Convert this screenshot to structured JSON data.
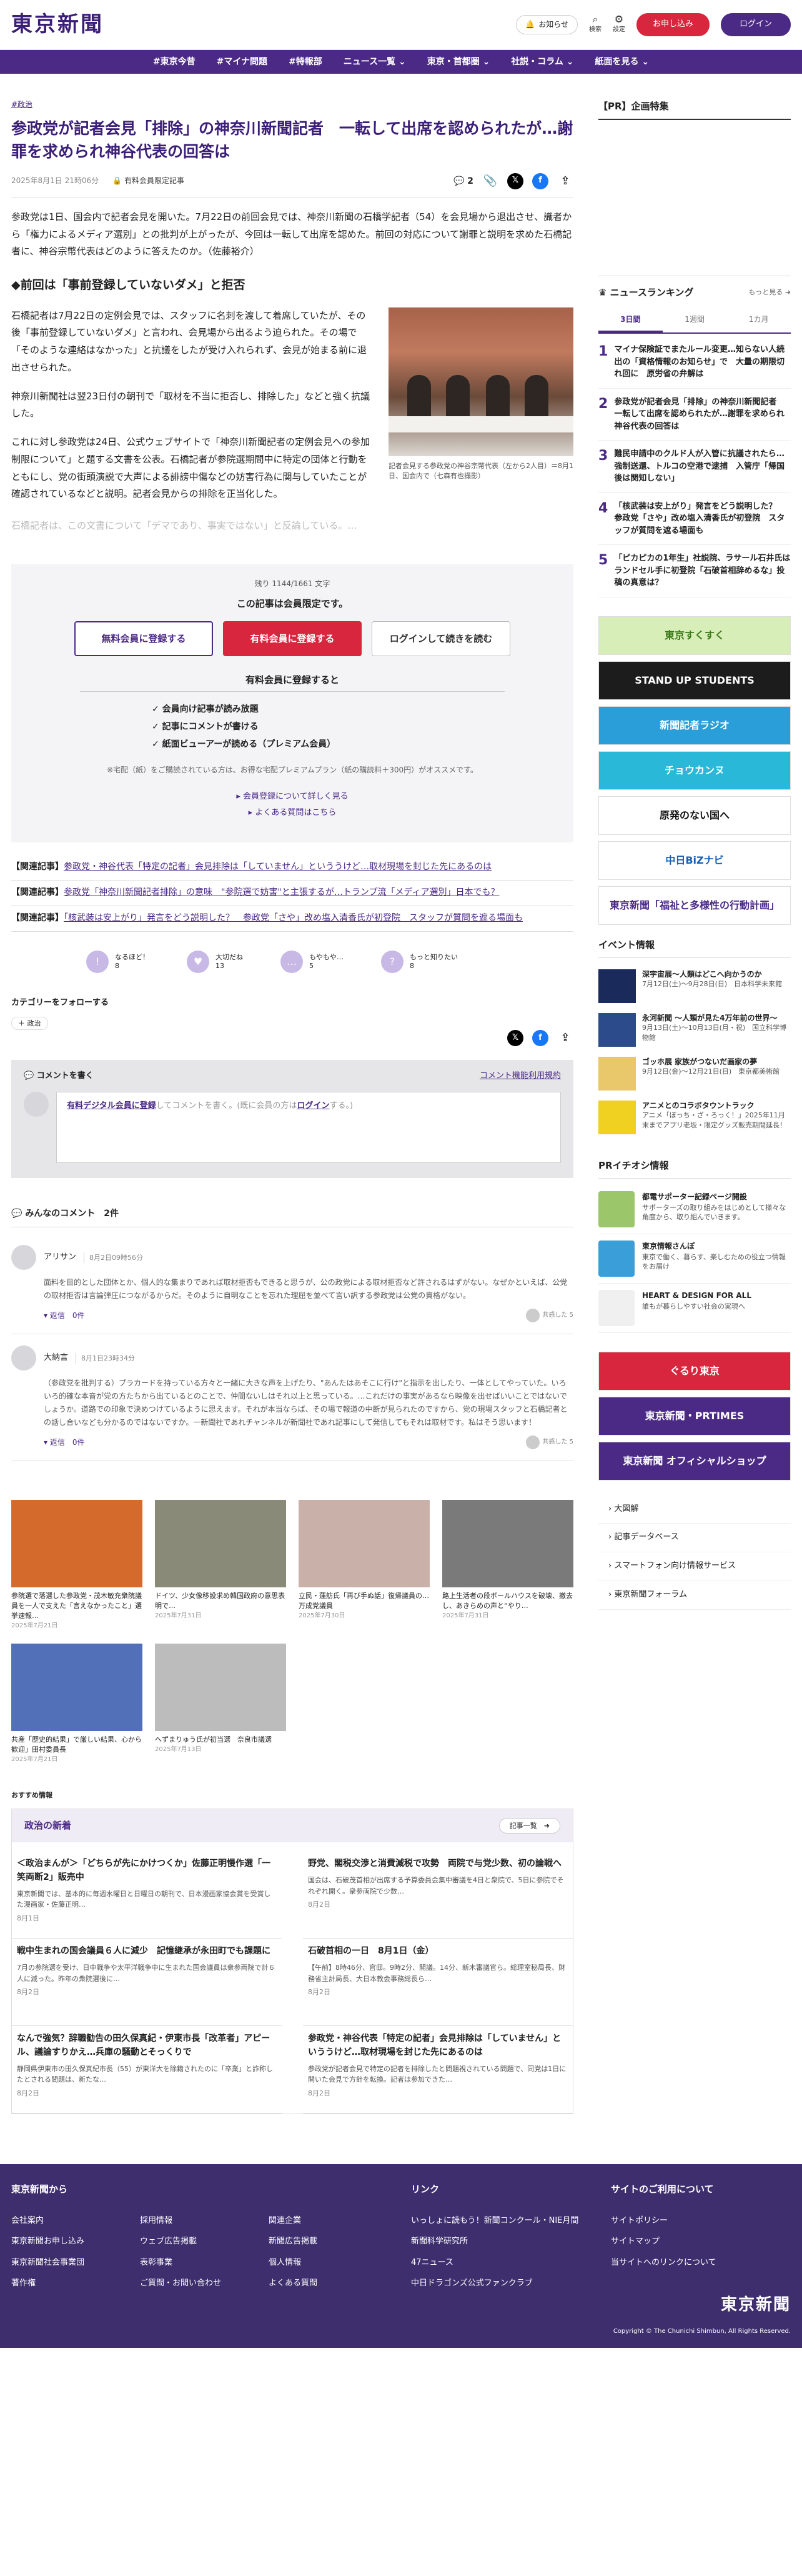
{
  "header": {
    "logo": "東京新聞",
    "notice": "お知らせ",
    "search": "検索",
    "settings": "設定",
    "apply": "お申し込み",
    "login": "ログイン"
  },
  "nav": [
    "#東京今昔",
    "#マイナ問題",
    "#特報部",
    "ニュース一覧 ⌄",
    "東京・首都圏 ⌄",
    "社説・コラム ⌄",
    "紙面を見る ⌄"
  ],
  "article": {
    "breadcrumb": "#政治",
    "title": "参政党が記者会見「排除」の神奈川新聞記者　一転して出席を認められたが…謝罪を求められ神谷代表の回答は",
    "date": "2025年8月1日 21時06分",
    "paid": "有料会員限定記事",
    "comment_count": "2",
    "lede": "参政党は1日、国会内で記者会見を開いた。7月22日の前回会見では、神奈川新聞の石橋学記者（54）を会見場から退出させ、識者から「権力によるメディア選別」との批判が上がったが、今回は一転して出席を認めた。前回の対応について謝罪と説明を求めた石橋記者に、神谷宗幣代表はどのように答えたのか。（佐藤裕介）",
    "heading": "◆前回は「事前登録していないダメ」と拒否",
    "paragraphs": [
      "石橋記者は7月22日の定例会見では、スタッフに名刺を渡して着席していたが、その後「事前登録していないダメ」と言われ、会見場から出るよう迫られた。その場で「そのような連絡はなかった」と抗議をしたが受け入れられず、会見が始まる前に退出させられた。",
      "神奈川新聞社は翌23日付の朝刊で「取材を不当に拒否し、排除した」などと強く抗議した。",
      "これに対し参政党は24日、公式ウェブサイトで「神奈川新聞記者の定例会見への参加制限について」と題する文書を公表。石橋記者が参院選期間中に特定の団体と行動をともにし、党の街頭演説で大声による誹謗中傷などの妨害行為に関与していたことが確認されているなどと説明。記者会見からの排除を正当化した。"
    ],
    "fade": "石橋記者は、この文書について「デマであり、事実ではない」と反論している。…",
    "caption": "記者会見する参政党の神谷宗幣代表（左から2人目）＝8月1日、国会内で（七森有也撮影）"
  },
  "paywall": {
    "remaining": "残り 1144/1661 文字",
    "limited": "この記事は会員限定です。",
    "free_btn": "無料会員に登録する",
    "paid_btn": "有料会員に登録する",
    "login_btn": "ログインして続きを読む",
    "benefit_title": "有料会員に登録すると",
    "benefits": [
      "✓ 会員向け記事が読み放題",
      "✓ 記事にコメントが書ける",
      "✓ 紙面ビューアーが読める（プレミアム会員）"
    ],
    "note": "※宅配（紙）をご購読されている方は、お得な宅配プレミアムプラン（紙の購読料＋300円）がオススメです。",
    "link1": "▸ 会員登録について詳しく見る",
    "link2": "▸ よくある質問はこちら"
  },
  "related": [
    {
      "tag": "【関連記事】",
      "text": "参政党・神谷代表「特定の記者」会見排除は「していません」といううけど…取材現場を封じた先にあるのは"
    },
    {
      "tag": "【関連記事】",
      "text": "参政党「神奈川新聞記者排除」の意味　\"参院選で妨害\"と主張するが…トランプ流「メディア選別」日本でも？"
    },
    {
      "tag": "【関連記事】",
      "text": "「核武装は安上がり」発言をどう説明した？　参政党「さや」改め塩入清香氏が初登院　スタッフが質問を遮る場面も"
    }
  ],
  "reactions": [
    {
      "label": "なるほど！",
      "count": "8",
      "icon": "!"
    },
    {
      "label": "大切だね",
      "count": "13",
      "icon": "♥"
    },
    {
      "label": "もやもや…",
      "count": "5",
      "icon": "…"
    },
    {
      "label": "もっと知りたい",
      "count": "8",
      "icon": "?"
    }
  ],
  "follow": {
    "title": "カテゴリーをフォローする",
    "tag": "＋ 政治"
  },
  "comment_box": {
    "title": "コメントを書く",
    "rules": "コメント機能利用規約",
    "prompt_pre": "有料デジタル会員に登録",
    "prompt_mid": "してコメントを書く。(既に会員の方は",
    "prompt_login": "ログイン",
    "prompt_end": "する。)"
  },
  "comments": {
    "title": "みんなのコメント　2件",
    "items": [
      {
        "name": "アリサン",
        "date": "8月2日09時56分",
        "text": "面料を目的とした団体とか、個人的な集まりであれば取材拒否もできると思うが、公の政党による取材拒否など許されるはずがない。なぜかといえば、公党の取材拒否は言論弾圧につながるからだ。そのように自明なことを忘れた理屈を並べて言い訳する参政党は公党の資格がない。",
        "reply": "▾ 返信　0件",
        "share": "共感した 5"
      },
      {
        "name": "大納言",
        "date": "8月1日23時34分",
        "text": "（参政党を批判する）プラカードを持っている方々と一緒に大きな声を上げたり、\"あんたはあそこに行け\"と指示を出したり、一体としてやっていた。いろいろ的確な本音が党の方たちから出ているとのことで、仲間ないしはそれ以上と思っている。…これだけの事実があるなら映像を出せばいいことではないでしょうか。道路での印象で決めつけているように思えます。それが本当ならば、その場で報道の中断が見られたのですから、党の現場スタッフと石橋記者との話し合いなども分かるのではないですか。一新聞社であれチャンネルが新聞社であれ記事にして発信してもそれは取材です。私はそう思います！",
        "reply": "▾ 返信　0件",
        "share": "共感した 5"
      }
    ]
  },
  "cards": [
    {
      "title": "参院選で落選した参政党・茂木敏充衆院議員を一人で支えた「言えなかったこと」選挙速報…",
      "date": "2025年7月21日",
      "color": "#d46a2c"
    },
    {
      "title": "ドイツ、少女像移設求め韓国政府の意思表明で…",
      "date": "2025年7月31日",
      "color": "#8a8a78"
    },
    {
      "title": "立民・蓮舫氏「再び手ぬ話」復帰議員の…万成党議員",
      "date": "2025年7月30日",
      "color": "#c9b0a8"
    },
    {
      "title": "路上生活者の段ボールハウスを破壊、撤去し、あきらめの声と“やり…",
      "date": "2025年7月31日",
      "color": "#7a7a7a"
    },
    {
      "title": "共産「歴史的結果」で厳しい結果、心から歓迎」田村委員長",
      "date": "2025年7月21日",
      "color": "#5270b8"
    },
    {
      "title": "へずまりゅう氏が初当選　奈良市議選",
      "date": "2025年7月13日",
      "color": "#bcbcbc"
    }
  ],
  "recommend": {
    "label": "おすすめ情報",
    "box_title": "政治の新着",
    "more": "記事一覧　➜",
    "items": [
      {
        "title": "＜政治まんが＞「どちらが先にかけつくか」佐藤正明慢作選「一笑両断2」販売中",
        "text": "東京新聞では、基本的に毎週水曜日と日曜日の朝刊で、日本漫画家協会賞を受賞した漫画家・佐藤正明…",
        "date": "8月1日"
      },
      {
        "title": "野党、閣税交渉と消費減税で攻勢　両院で与党少数、初の論戦へ",
        "text": "国会は、石破茂首相が出席する予算委員会集中審議を4日と衆院で、5日に参院でそれぞれ開く。衆参両院で少数…",
        "date": "8月2日"
      },
      {
        "title": "戦中生まれの国会議員６人に減少　記憶継承が永田町でも課題に",
        "text": "7月の参院選を受け、日中戦争や太平洋戦争中に生まれた国会議員は衆参両院で計６人に減った。昨年の衆院選後に…",
        "date": "8月2日"
      },
      {
        "title": "石破首相の一日　8月1日（金）",
        "text": "【午前】8時46分、官邸。9時2分、閣議。14分、新木審議官ら。総理室秘局長、財務省主計局長、大日本教会事務総長ら…",
        "date": "8月2日"
      },
      {
        "title": "なんで強気？辞職勧告の田久保真紀・伊東市長「改革者」アピール、議論すりかえ…兵庫の騒動とそっくりで",
        "text": "静岡県伊東市の田久保真紀市長（55）が東洋大を除籍されたのに「卒業」と詐称したとされる問題は、新たな…",
        "date": "8月2日"
      },
      {
        "title": "参政党・神谷代表「特定の記者」会見排除は「していません」といううけど…取材現場を封じた先にあるのは",
        "text": "参政党が記者会見で特定の記者を排除したと問題視されている問題で、同党は1日に開いた会見で方針を転換。記者は参加できた…",
        "date": "8月2日"
      }
    ]
  },
  "sidebar": {
    "pr_title": "【PR】企画特集",
    "ranking_title": "ニュースランキング",
    "ranking_more": "もっと見る ➜",
    "tabs": [
      "3日間",
      "1週間",
      "1カ月"
    ],
    "ranking": [
      {
        "n": "1",
        "title": "マイナ保険証でまたルール変更…知らない人続出の「資格情報のお知らせ」で　大量の期限切れ回に　原労省の弁解は"
      },
      {
        "n": "2",
        "title": "参政党が記者会見「排除」の神奈川新聞記者　一転して出席を認められたが…謝罪を求められ神谷代表の回答は"
      },
      {
        "n": "3",
        "title": "難民申請中のクルド人が入管に抗議されたら…強制送還、トルコの空港で逮捕　入管庁「帰国後は関知しない」"
      },
      {
        "n": "4",
        "title": "「核武装は安上がり」発言をどう説明した？　参政党「さや」改め塩入清香氏が初登院　スタッフが質問を遮る場面も"
      },
      {
        "n": "5",
        "title": "「ピカピカの1年生」社説院、ラサール石井氏はランドセル手に初登院「石破首相辞めるな」投稿の真意は？"
      }
    ],
    "banners": [
      {
        "text": "東京すくすく",
        "bg": "#d8eeb8",
        "fg": "#3a7a1a"
      },
      {
        "text": "STAND UP STUDENTS",
        "bg": "#1c1c1c",
        "fg": "#ffffff"
      },
      {
        "text": "新聞記者ラジオ",
        "bg": "#2a9ed8",
        "fg": "#ffffff"
      },
      {
        "text": "チョウカンヌ",
        "bg": "#29b8d8",
        "fg": "#ffffff"
      },
      {
        "text": "原発のない国へ",
        "bg": "#ffffff",
        "fg": "#111111"
      },
      {
        "text": "中日BiZナビ",
        "bg": "#ffffff",
        "fg": "#1a5fb4"
      },
      {
        "text": "東京新聞「福祉と多様性の行動計画」",
        "bg": "#ffffff",
        "fg": "#4b2a86"
      }
    ],
    "events_title": "イベント情報",
    "events": [
      {
        "title": "深宇宙展～人類はどこへ向かうのか",
        "text": "7月12日(土)～9月28日(日)　日本科学未来館",
        "color": "#1a2a5a"
      },
      {
        "title": "永河新聞 ～人類が見た4万年前の世界～",
        "text": "9月13日(土)～10月13日(月・祝)　国立科学博物館",
        "color": "#2b4b8a"
      },
      {
        "title": "ゴッホ展 家族がつないだ画家の夢",
        "text": "9月12日(金)～12月21日(日)　東京都美術館",
        "color": "#e8c86a"
      },
      {
        "title": "アニメとのコラボタウントラック",
        "text": "アニメ「ぼっち・ざ・ろっく！」2025年11月末までアプリ老坂・限定グッズ販売期間延長！",
        "color": "#f0d020"
      }
    ],
    "pri_title": "PRイチオシ情報",
    "pri": [
      {
        "title": "都電サポーター記録ページ開設",
        "text": "サポーターズの取り組みをはじめとして様々な角度から、取り組んでいきます。",
        "color": "#9bc66a"
      },
      {
        "title": "東京情報さんぽ",
        "text": "東京で働く、暮らす、楽しむための役立つ情報をお届け",
        "color": "#3a9fd8"
      },
      {
        "title": "HEART & DESIGN FOR ALL",
        "text": "誰もが暮らしやすい社会の実現へ",
        "color": "#f0f0f0"
      }
    ],
    "banners2": [
      {
        "text": "ぐるり東京",
        "bg": "#d7263d",
        "fg": "#ffffff"
      },
      {
        "text": "東京新聞・PRTIMES",
        "bg": "#4b2a86",
        "fg": "#ffffff"
      },
      {
        "text": "東京新聞 オフィシャルショップ",
        "bg": "#4b2a86",
        "fg": "#ffffff"
      }
    ],
    "links": [
      "› 大図解",
      "› 記事データベース",
      "› スマートフォン向け情報サービス",
      "› 東京新聞フォーラム"
    ]
  },
  "footer": {
    "col1_title": "東京新聞から",
    "col1_links": [
      "会社案内",
      "採用情報",
      "関連企業",
      "東京新聞お申し込み",
      "ウェブ広告掲載",
      "新聞広告掲載",
      "東京新聞社会事業団",
      "表彰事業",
      "個人情報",
      "著作権",
      "ご質問・お問い合わせ",
      "よくある質問"
    ],
    "col2_title": "リンク",
    "col2_links": [
      "いっしょに読もう！新聞コンクール・NIE月間",
      "新聞科学研究所",
      "47ニュース",
      "中日ドラゴンズ公式ファンクラブ"
    ],
    "col3_title": "サイトのご利用について",
    "col3_links": [
      "サイトポリシー",
      "サイトマップ",
      "当サイトへのリンクについて"
    ],
    "logo": "東京新聞",
    "copyright": "Copyright © The Chunichi Shimbun, All Rights Reserved."
  }
}
